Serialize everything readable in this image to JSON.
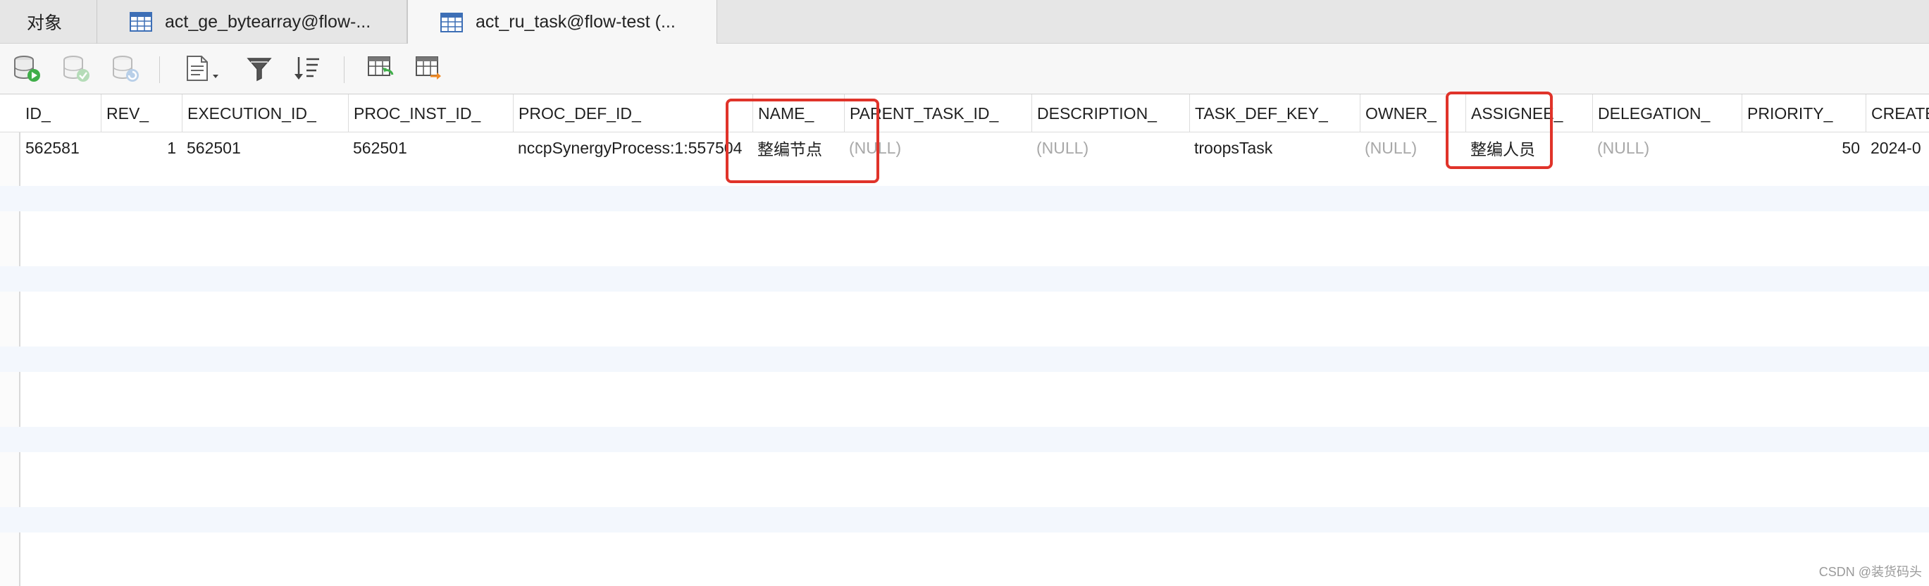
{
  "tabs": [
    {
      "label": "对象",
      "active": false
    },
    {
      "label": "act_ge_bytearray@flow-...",
      "active": false
    },
    {
      "label": "act_ru_task@flow-test (...",
      "active": true
    }
  ],
  "toolbar": {
    "icons": [
      "db-run-icon",
      "db-commit-icon",
      "db-refresh-icon",
      "document-dropdown-icon",
      "filter-icon",
      "sort-icon",
      "import-table-icon",
      "export-table-icon"
    ]
  },
  "grid": {
    "columns": [
      "ID_",
      "REV_",
      "EXECUTION_ID_",
      "PROC_INST_ID_",
      "PROC_DEF_ID_",
      "NAME_",
      "PARENT_TASK_ID_",
      "DESCRIPTION_",
      "TASK_DEF_KEY_",
      "OWNER_",
      "ASSIGNEE_",
      "DELEGATION_",
      "PRIORITY_",
      "CREATE"
    ],
    "rows": [
      [
        "562581",
        "1",
        "562501",
        "562501",
        "nccpSynergyProcess:1:557504",
        "整编节点",
        "(NULL)",
        "(NULL)",
        "troopsTask",
        "(NULL)",
        "整编人员",
        "(NULL)",
        "50",
        "2024-0"
      ]
    ]
  },
  "accent_colors": {
    "highlight": "#e0332a",
    "stripe": "#f3f7fd",
    "null_text": "#a8a8a8"
  },
  "watermark": "CSDN @装货码头"
}
